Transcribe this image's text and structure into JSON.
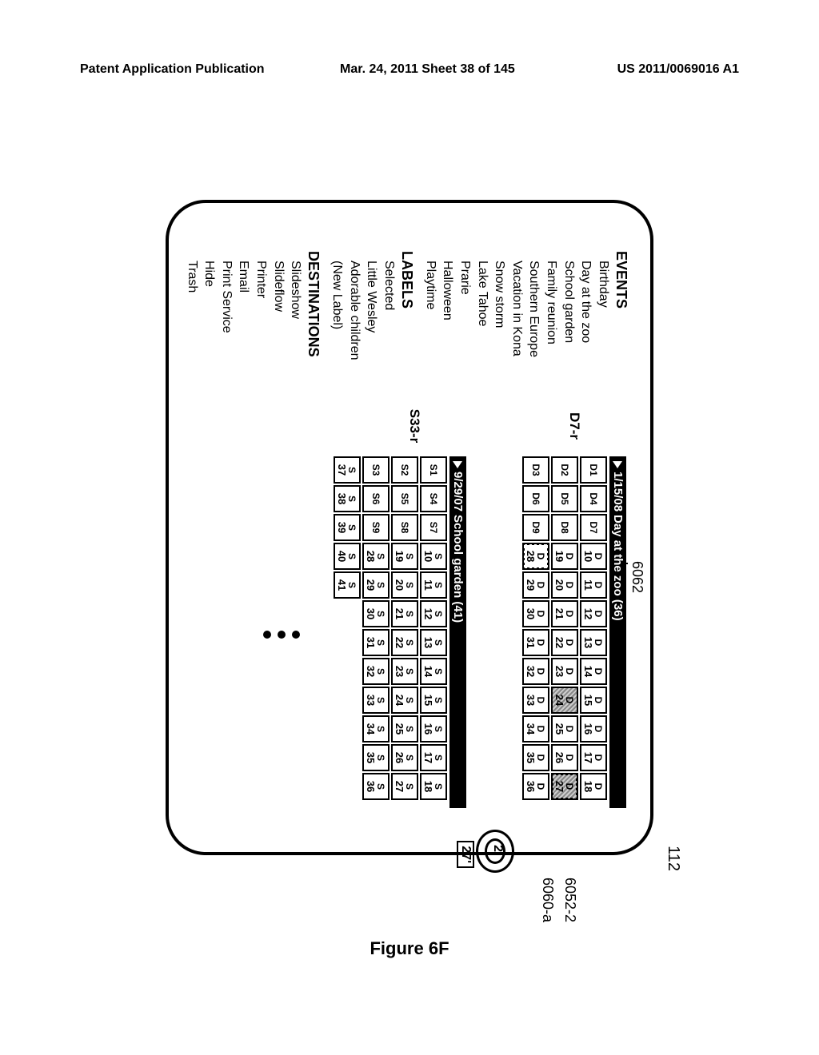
{
  "header": {
    "left": "Patent Application Publication",
    "center": "Mar. 24, 2011  Sheet 38 of 145",
    "right": "US 2011/0069016 A1"
  },
  "figure_label": "Figure 6F",
  "refs": {
    "device": "112",
    "thumb": "6062",
    "touch_a": "6052-2",
    "touch_b": "6060-a"
  },
  "sidebar": {
    "events_heading": "EVENTS",
    "events": [
      "Birthday",
      "Day at the zoo",
      "School garden",
      "Family reunion",
      "Southern Europe",
      "Vacation in Kona",
      "Snow storm",
      "Lake Tahoe",
      "Prarie",
      "Halloween",
      "Playtime"
    ],
    "labels_heading": "LABELS",
    "labels": [
      "Selected",
      "Little Wesley",
      "Adorable children",
      "(New Label)"
    ],
    "dest_heading": "DESTINATIONS",
    "destinations": [
      "Slideshow",
      "Slideflow",
      "Printer",
      "Email",
      "Print Service",
      "Hide",
      "Trash"
    ]
  },
  "groups": [
    {
      "rep": "D7-r",
      "date": "1/15/08",
      "title": "Day at the zoo (36)",
      "prefix": "D",
      "count": 36,
      "selected": [
        24,
        27
      ],
      "dotted": [
        27,
        28
      ]
    },
    {
      "rep": "S33-r",
      "date": "9/29/07",
      "title": "School garden (41)",
      "prefix": "S",
      "count": 41,
      "selected": [],
      "dotted": []
    }
  ],
  "touch": {
    "primary_label": "2",
    "secondary_label": "27'"
  }
}
